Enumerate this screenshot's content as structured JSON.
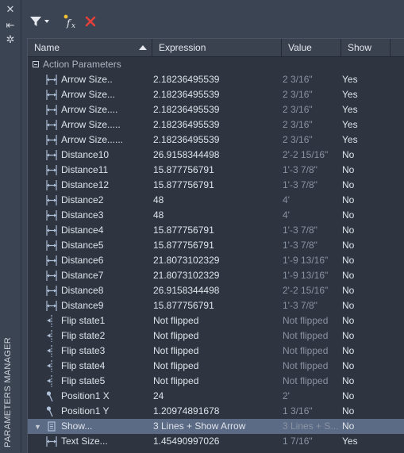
{
  "palette": "PARAMETERS MANAGER",
  "side_controls": {
    "close": "close-icon",
    "pin": "autohide-icon",
    "props": "properties-icon"
  },
  "toolbar": {
    "filter": "filter-icon",
    "new_param": "new-parameter-icon",
    "delete": "delete-icon"
  },
  "columns": {
    "name": "Name",
    "expression": "Expression",
    "value": "Value",
    "show": "Show"
  },
  "group": "Action Parameters",
  "rows": [
    {
      "name": "Arrow Size..",
      "expr": "2.18236495539",
      "val": "2 3/16\"",
      "show": "Yes",
      "icon": "linear"
    },
    {
      "name": "Arrow Size...",
      "expr": "2.18236495539",
      "val": "2 3/16\"",
      "show": "Yes",
      "icon": "linear"
    },
    {
      "name": "Arrow Size....",
      "expr": "2.18236495539",
      "val": "2 3/16\"",
      "show": "Yes",
      "icon": "linear"
    },
    {
      "name": "Arrow Size.....",
      "expr": "2.18236495539",
      "val": "2 3/16\"",
      "show": "Yes",
      "icon": "linear"
    },
    {
      "name": "Arrow Size......",
      "expr": "2.18236495539",
      "val": "2 3/16\"",
      "show": "Yes",
      "icon": "linear"
    },
    {
      "name": "Distance10",
      "expr": "26.9158344498",
      "val": "2'-2 15/16\"",
      "show": "No",
      "icon": "linear"
    },
    {
      "name": "Distance11",
      "expr": "15.877756791",
      "val": "1'-3 7/8\"",
      "show": "No",
      "icon": "linear"
    },
    {
      "name": "Distance12",
      "expr": "15.877756791",
      "val": "1'-3 7/8\"",
      "show": "No",
      "icon": "linear"
    },
    {
      "name": "Distance2",
      "expr": "48",
      "val": "4'",
      "show": "No",
      "icon": "linear"
    },
    {
      "name": "Distance3",
      "expr": "48",
      "val": "4'",
      "show": "No",
      "icon": "linear"
    },
    {
      "name": "Distance4",
      "expr": "15.877756791",
      "val": "1'-3 7/8\"",
      "show": "No",
      "icon": "linear"
    },
    {
      "name": "Distance5",
      "expr": "15.877756791",
      "val": "1'-3 7/8\"",
      "show": "No",
      "icon": "linear"
    },
    {
      "name": "Distance6",
      "expr": "21.8073102329",
      "val": "1'-9 13/16\"",
      "show": "No",
      "icon": "linear"
    },
    {
      "name": "Distance7",
      "expr": "21.8073102329",
      "val": "1'-9 13/16\"",
      "show": "No",
      "icon": "linear"
    },
    {
      "name": "Distance8",
      "expr": "26.9158344498",
      "val": "2'-2 15/16\"",
      "show": "No",
      "icon": "linear"
    },
    {
      "name": "Distance9",
      "expr": "15.877756791",
      "val": "1'-3 7/8\"",
      "show": "No",
      "icon": "linear"
    },
    {
      "name": "Flip state1",
      "expr": "Not flipped",
      "val": "Not flipped",
      "show": "No",
      "icon": "flip"
    },
    {
      "name": "Flip state2",
      "expr": "Not flipped",
      "val": "Not flipped",
      "show": "No",
      "icon": "flip"
    },
    {
      "name": "Flip state3",
      "expr": "Not flipped",
      "val": "Not flipped",
      "show": "No",
      "icon": "flip"
    },
    {
      "name": "Flip state4",
      "expr": "Not flipped",
      "val": "Not flipped",
      "show": "No",
      "icon": "flip"
    },
    {
      "name": "Flip state5",
      "expr": "Not flipped",
      "val": "Not flipped",
      "show": "No",
      "icon": "flip"
    },
    {
      "name": "Position1 X",
      "expr": "24",
      "val": "2'",
      "show": "No",
      "icon": "point"
    },
    {
      "name": "Position1 Y",
      "expr": "1.20974891678",
      "val": "1 3/16\"",
      "show": "No",
      "icon": "point"
    },
    {
      "name": "Show...",
      "expr": "3 Lines + Show Arrow",
      "val": "3 Lines + S...",
      "show": "No",
      "icon": "visibility",
      "selected": true
    },
    {
      "name": "Text Size...",
      "expr": "1.45490997026",
      "val": "1 7/16\"",
      "show": "Yes",
      "icon": "linear"
    }
  ]
}
